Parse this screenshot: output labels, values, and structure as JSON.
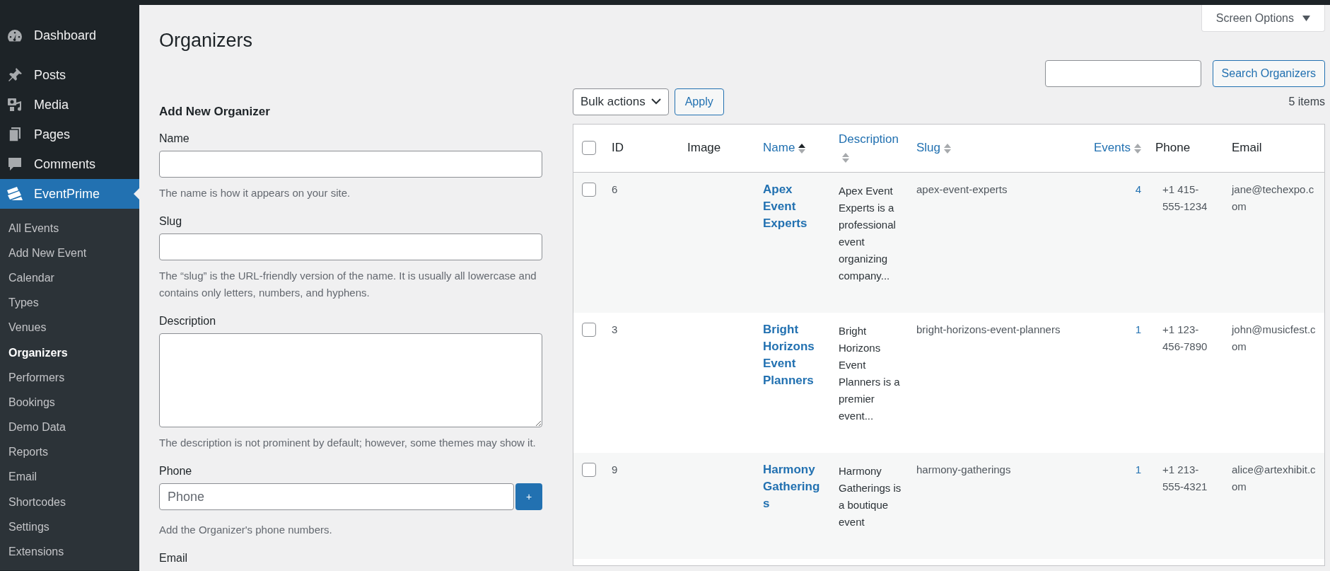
{
  "sidebar": {
    "menu": [
      {
        "label": "Dashboard",
        "selected": false
      },
      {
        "label": "Posts",
        "selected": false
      },
      {
        "label": "Media",
        "selected": false
      },
      {
        "label": "Pages",
        "selected": false
      },
      {
        "label": "Comments",
        "selected": false
      },
      {
        "label": "EventPrime",
        "selected": true
      }
    ],
    "submenu": [
      {
        "label": "All Events",
        "selected": false
      },
      {
        "label": "Add New Event",
        "selected": false
      },
      {
        "label": "Calendar",
        "selected": false
      },
      {
        "label": "Types",
        "selected": false
      },
      {
        "label": "Venues",
        "selected": false
      },
      {
        "label": "Organizers",
        "selected": true
      },
      {
        "label": "Performers",
        "selected": false
      },
      {
        "label": "Bookings",
        "selected": false
      },
      {
        "label": "Demo Data",
        "selected": false
      },
      {
        "label": "Reports",
        "selected": false
      },
      {
        "label": "Email",
        "selected": false
      },
      {
        "label": "Shortcodes",
        "selected": false
      },
      {
        "label": "Settings",
        "selected": false
      },
      {
        "label": "Extensions",
        "selected": false
      }
    ]
  },
  "page": {
    "title": "Organizers",
    "screen_options": "Screen Options",
    "search_button": "Search Organizers"
  },
  "form": {
    "heading": "Add New Organizer",
    "fields": [
      {
        "kind": "text",
        "label": "Name",
        "help": "The name is how it appears on your site."
      },
      {
        "kind": "text",
        "label": "Slug",
        "help": "The “slug” is the URL-friendly version of the name. It is usually all lowercase and contains only letters, numbers, and hyphens."
      },
      {
        "kind": "textarea",
        "label": "Description",
        "help": "The description is not prominent by default; however, some themes may show it."
      },
      {
        "kind": "phone",
        "label": "Phone",
        "placeholder": "Phone",
        "add_button": "+",
        "help": "Add the Organizer's phone numbers."
      },
      {
        "kind": "text",
        "label": "Email"
      }
    ]
  },
  "table": {
    "bulk_actions": "Bulk actions",
    "apply": "Apply",
    "count": "5 items",
    "select_all_checked": false,
    "columns": [
      {
        "label": "ID"
      },
      {
        "label": "Image"
      },
      {
        "label": "Name",
        "sorted": true
      },
      {
        "label": "Description",
        "sorted": false
      },
      {
        "label": "Slug",
        "sorted": false
      },
      {
        "label": "Events",
        "sorted": false
      },
      {
        "label": "Phone"
      },
      {
        "label": "Email"
      }
    ],
    "rows": [
      {
        "checked": false,
        "id": "6",
        "name": "Apex Event Experts",
        "description": "Apex Event Experts is a professional event organizing company...",
        "slug": "apex-event-experts",
        "events": "4",
        "phone": "+1 415-555-1234",
        "email": "jane@techexpo.com"
      },
      {
        "checked": false,
        "id": "3",
        "name": "Bright Horizons Event Planners",
        "description": "Bright Horizons Event Planners is a premier event...",
        "slug": "bright-horizons-event-planners",
        "events": "1",
        "phone": "+1 123-456-7890",
        "email": "john@musicfest.com"
      },
      {
        "checked": false,
        "id": "9",
        "name": "Harmony Gatherings",
        "description": "Harmony Gatherings is a boutique event",
        "slug": "harmony-gatherings",
        "events": "1",
        "phone": "+1 213-555-4321",
        "email": "alice@artexhibit.com"
      }
    ]
  }
}
